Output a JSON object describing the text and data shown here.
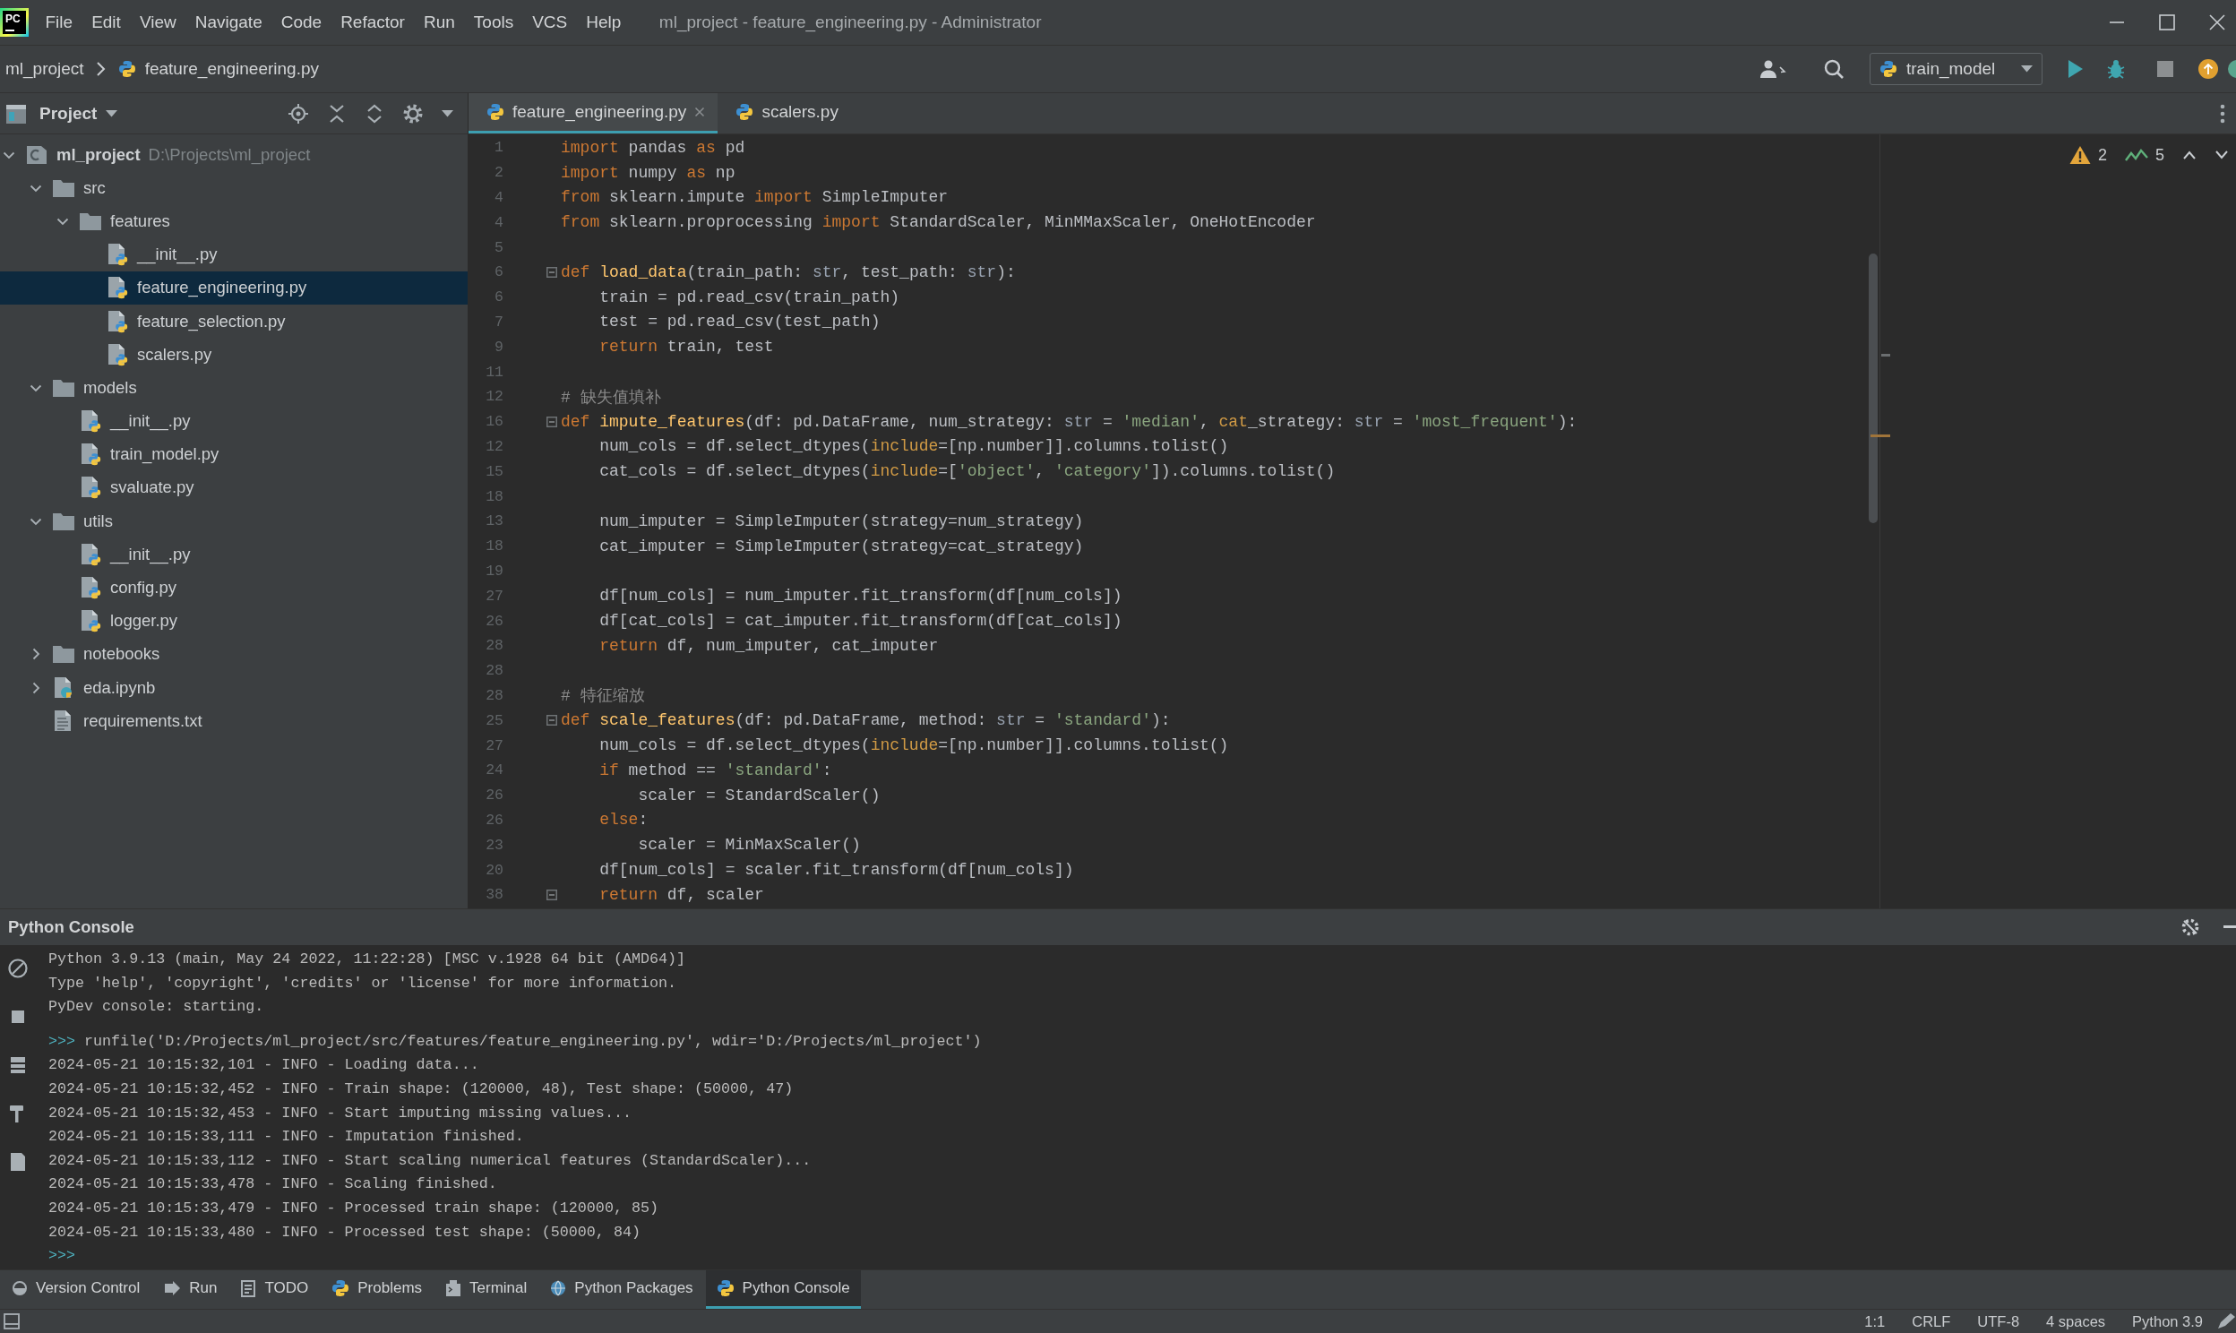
{
  "window": {
    "logo": "PC",
    "menu": [
      "File",
      "Edit",
      "View",
      "Navigate",
      "Code",
      "Refactor",
      "Run",
      "Tools",
      "VCS",
      "Help"
    ],
    "title": "ml_project - feature_engineering.py - Administrator"
  },
  "navigation_bar": {
    "breadcrumb": [
      {
        "label": "ml_project",
        "kind": "project"
      },
      {
        "label": "feature_engineering.py",
        "kind": "python"
      }
    ],
    "run_configuration": "train_model"
  },
  "project_panel": {
    "title": "Project",
    "tree": [
      {
        "name": "ml_project",
        "path": "D:\\Projects\\ml_project",
        "kind": "project",
        "expanded": true,
        "selected": false,
        "children": [
          {
            "name": "src",
            "kind": "folder",
            "expanded": true,
            "selected": false,
            "children": [
              {
                "name": "features",
                "kind": "folder",
                "expanded": true,
                "selected": false,
                "children": [
                  {
                    "name": "__init__.py",
                    "kind": "python",
                    "selected": false
                  },
                  {
                    "name": "feature_engineering.py",
                    "kind": "python",
                    "selected": true
                  },
                  {
                    "name": "feature_selection.py",
                    "kind": "python",
                    "selected": false
                  },
                  {
                    "name": "scalers.py",
                    "kind": "python",
                    "selected": false
                  }
                ]
              }
            ]
          },
          {
            "name": "models",
            "kind": "folder",
            "expanded": true,
            "selected": false,
            "children": [
              {
                "name": "__init__.py",
                "kind": "python",
                "selected": false
              },
              {
                "name": "train_model.py",
                "kind": "python",
                "selected": false
              },
              {
                "name": "svaluate.py",
                "kind": "python",
                "selected": false
              }
            ]
          },
          {
            "name": "utils",
            "kind": "folder",
            "expanded": true,
            "selected": false,
            "children": [
              {
                "name": "__init__.py",
                "kind": "python",
                "selected": false
              },
              {
                "name": "config.py",
                "kind": "python",
                "selected": false
              },
              {
                "name": "logger.py",
                "kind": "python",
                "selected": false
              }
            ]
          },
          {
            "name": "notebooks",
            "kind": "folder",
            "expanded": false,
            "selected": false
          },
          {
            "name": "eda.ipynb",
            "kind": "notebook",
            "expanded": false,
            "selected": false
          },
          {
            "name": "requirements.txt",
            "kind": "text",
            "selected": false
          }
        ]
      }
    ]
  },
  "editor": {
    "tabs": [
      {
        "label": "feature_engineering.py",
        "selected": true,
        "closable": true
      },
      {
        "label": "scalers.py",
        "selected": false,
        "closable": false
      }
    ],
    "inspections": {
      "warnings": "2",
      "weak_warnings": "5"
    },
    "lines": [
      {
        "number": "1",
        "fold_marker": false,
        "tokens": [
          {
            "kind": "keyword",
            "text": "import"
          },
          {
            "kind": "plain",
            "text": " pandas "
          },
          {
            "kind": "keyword",
            "text": "as"
          },
          {
            "kind": "plain",
            "text": " pd"
          }
        ]
      },
      {
        "number": "2",
        "fold_marker": false,
        "tokens": [
          {
            "kind": "keyword",
            "text": "import"
          },
          {
            "kind": "plain",
            "text": " numpy "
          },
          {
            "kind": "keyword",
            "text": "as"
          },
          {
            "kind": "plain",
            "text": " np"
          }
        ]
      },
      {
        "number": "4",
        "fold_marker": false,
        "tokens": [
          {
            "kind": "keyword",
            "text": "from"
          },
          {
            "kind": "plain",
            "text": " sklearn.impute "
          },
          {
            "kind": "keyword",
            "text": "import"
          },
          {
            "kind": "plain",
            "text": " SimpleImputer"
          }
        ]
      },
      {
        "number": "4",
        "fold_marker": false,
        "tokens": [
          {
            "kind": "keyword",
            "text": "from"
          },
          {
            "kind": "plain",
            "text": " sklearn.proprocessing "
          },
          {
            "kind": "keyword",
            "text": "import"
          },
          {
            "kind": "plain",
            "text": " StandardScaler, MinMMaxScaler, OneHotEncoder"
          }
        ]
      },
      {
        "number": "5",
        "fold_marker": false
      },
      {
        "number": "6",
        "fold_marker": true,
        "tokens": [
          {
            "kind": "keyword",
            "text": "def "
          },
          {
            "kind": "function",
            "text": "load_data"
          },
          {
            "kind": "plain",
            "text": "(train_path: "
          },
          {
            "kind": "builtin",
            "text": "str"
          },
          {
            "kind": "plain",
            "text": ", test_path: "
          },
          {
            "kind": "builtin",
            "text": "str"
          },
          {
            "kind": "plain",
            "text": "):"
          }
        ]
      },
      {
        "number": "6",
        "fold_marker": false,
        "tokens": [
          {
            "kind": "plain",
            "text": "    train = pd.read_csv(train_path)"
          }
        ]
      },
      {
        "number": "7",
        "fold_marker": false,
        "tokens": [
          {
            "kind": "plain",
            "text": "    test = pd.read_csv(test_path)"
          }
        ]
      },
      {
        "number": "9",
        "fold_marker": false,
        "tokens": [
          {
            "kind": "keyword",
            "text": "    return"
          },
          {
            "kind": "plain",
            "text": " train, test"
          }
        ]
      },
      {
        "number": "11",
        "fold_marker": false
      },
      {
        "number": "12",
        "fold_marker": false,
        "tokens": [
          {
            "kind": "comment",
            "text": "# 缺失值填补"
          }
        ]
      },
      {
        "number": "16",
        "fold_marker": true,
        "tokens": [
          {
            "kind": "keyword",
            "text": "def "
          },
          {
            "kind": "function",
            "text": "impute_features"
          },
          {
            "kind": "plain",
            "text": "(df: pd.DataFrame, num_strategy: "
          },
          {
            "kind": "builtin",
            "text": "str"
          },
          {
            "kind": "plain",
            "text": " = "
          },
          {
            "kind": "string",
            "text": "'median'"
          },
          {
            "kind": "plain",
            "text": ", "
          },
          {
            "kind": "argument",
            "text": "cat"
          },
          {
            "kind": "plain",
            "text": "_strategy: "
          },
          {
            "kind": "builtin",
            "text": "str"
          },
          {
            "kind": "plain",
            "text": " = "
          },
          {
            "kind": "string",
            "text": "'most_frequent'"
          },
          {
            "kind": "plain",
            "text": "):"
          }
        ]
      },
      {
        "number": "12",
        "fold_marker": false,
        "tokens": [
          {
            "kind": "plain",
            "text": "    num_cols = df.select_dtypes("
          },
          {
            "kind": "argument",
            "text": "include"
          },
          {
            "kind": "plain",
            "text": "=[np.number]].columns.tolist()"
          }
        ]
      },
      {
        "number": "15",
        "fold_marker": false,
        "tokens": [
          {
            "kind": "plain",
            "text": "    cat_cols = df.select_dtypes("
          },
          {
            "kind": "argument",
            "text": "include"
          },
          {
            "kind": "plain",
            "text": "=["
          },
          {
            "kind": "string",
            "text": "'object'"
          },
          {
            "kind": "plain",
            "text": ", "
          },
          {
            "kind": "string",
            "text": "'category'"
          },
          {
            "kind": "plain",
            "text": "]).columns.tolist()"
          }
        ]
      },
      {
        "number": "18",
        "fold_marker": false
      },
      {
        "number": "13",
        "fold_marker": false,
        "tokens": [
          {
            "kind": "plain",
            "text": "    num_imputer = SimpleImputer(strategy=num_strategy)"
          }
        ]
      },
      {
        "number": "18",
        "fold_marker": false,
        "tokens": [
          {
            "kind": "plain",
            "text": "    cat_imputer = SimpleImputer(strategy=cat_strategy)"
          }
        ]
      },
      {
        "number": "19",
        "fold_marker": false
      },
      {
        "number": "27",
        "fold_marker": false,
        "tokens": [
          {
            "kind": "plain",
            "text": "    df[num_cols] = num_imputer.fit_transform(df[num_cols])"
          }
        ]
      },
      {
        "number": "26",
        "fold_marker": false,
        "tokens": [
          {
            "kind": "plain",
            "text": "    df[cat_cols] = cat_imputer.fit_transform(df[cat_cols])"
          }
        ]
      },
      {
        "number": "28",
        "fold_marker": false,
        "tokens": [
          {
            "kind": "keyword",
            "text": "    return"
          },
          {
            "kind": "plain",
            "text": " df, num_imputer, cat_imputer"
          }
        ]
      },
      {
        "number": "28",
        "fold_marker": false
      },
      {
        "number": "28",
        "fold_marker": false,
        "tokens": [
          {
            "kind": "comment",
            "text": "# 特征缩放"
          }
        ]
      },
      {
        "number": "25",
        "fold_marker": true,
        "tokens": [
          {
            "kind": "keyword",
            "text": "def "
          },
          {
            "kind": "function",
            "text": "scale_features"
          },
          {
            "kind": "plain",
            "text": "(df: pd.DataFrame, method: "
          },
          {
            "kind": "builtin",
            "text": "str"
          },
          {
            "kind": "plain",
            "text": " = "
          },
          {
            "kind": "string",
            "text": "'standard'"
          },
          {
            "kind": "plain",
            "text": "):"
          }
        ]
      },
      {
        "number": "27",
        "fold_marker": false,
        "tokens": [
          {
            "kind": "plain",
            "text": "    num_cols = df.select_dtypes("
          },
          {
            "kind": "argument",
            "text": "include"
          },
          {
            "kind": "plain",
            "text": "=[np.number]].columns.tolist()"
          }
        ]
      },
      {
        "number": "24",
        "fold_marker": false,
        "tokens": [
          {
            "kind": "keyword",
            "text": "    if"
          },
          {
            "kind": "plain",
            "text": " method == "
          },
          {
            "kind": "string",
            "text": "'standard'"
          },
          {
            "kind": "plain",
            "text": ":"
          }
        ]
      },
      {
        "number": "26",
        "fold_marker": false,
        "tokens": [
          {
            "kind": "plain",
            "text": "        scaler = StandardScaler()"
          }
        ]
      },
      {
        "number": "26",
        "fold_marker": false,
        "tokens": [
          {
            "kind": "keyword",
            "text": "    else"
          },
          {
            "kind": "plain",
            "text": ":"
          }
        ]
      },
      {
        "number": "23",
        "fold_marker": false,
        "tokens": [
          {
            "kind": "plain",
            "text": "        scaler = MinMaxScaler()"
          }
        ]
      },
      {
        "number": "20",
        "fold_marker": false,
        "tokens": [
          {
            "kind": "plain",
            "text": "    df[num_cols] = scaler.fit_transform(df[num_cols])"
          }
        ]
      },
      {
        "number": "38",
        "fold_marker": true,
        "tokens": [
          {
            "kind": "keyword",
            "text": "    return"
          },
          {
            "kind": "plain",
            "text": " df, scaler"
          }
        ]
      }
    ]
  },
  "console": {
    "title": "Python Console",
    "banner": [
      "Python 3.9.13 (main, May 24 2022, 11:22:28) [MSC v.1928 64 bit (AMD64)]",
      "Type 'help', 'copyright', 'credits' or 'license' for more information.",
      "PyDev console: starting."
    ],
    "session": [
      {
        "prompt": ">>>",
        "text": "runfile('D:/Projects/ml_project/src/features/feature_engineering.py', wdir='D:/Projects/ml_project')"
      },
      {
        "text": "2024-05-21 10:15:32,101 - INFO - Loading data..."
      },
      {
        "text": "2024-05-21 10:15:32,452 - INFO - Train shape: (120000, 48), Test shape: (50000, 47)"
      },
      {
        "text": "2024-05-21 10:15:32,453 - INFO - Start imputing missing values..."
      },
      {
        "text": "2024-05-21 10:15:33,111 - INFO - Imputation finished."
      },
      {
        "text": "2024-05-21 10:15:33,112 - INFO - Start scaling numerical features (StandardScaler)..."
      },
      {
        "text": "2024-05-21 10:15:33,478 - INFO - Scaling finished."
      },
      {
        "text": "2024-05-21 10:15:33,479 - INFO - Processed train shape: (120000, 85)"
      },
      {
        "text": "2024-05-21 10:15:33,480 - INFO - Processed test shape: (50000, 84)"
      },
      {
        "prompt": ">>>"
      }
    ]
  },
  "tool_window_bar": [
    {
      "label": "Version Control",
      "kind": "vcs",
      "selected": false
    },
    {
      "label": "Run",
      "kind": "run",
      "selected": false
    },
    {
      "label": "TODO",
      "kind": "todo",
      "selected": false
    },
    {
      "label": "Problems",
      "kind": "problems",
      "selected": false
    },
    {
      "label": "Terminal",
      "kind": "terminal",
      "selected": false
    },
    {
      "label": "Python Packages",
      "kind": "packages",
      "selected": false
    },
    {
      "label": "Python Console",
      "kind": "console",
      "selected": true
    }
  ],
  "status_bar": [
    "1:1",
    "CRLF",
    "UTF-8",
    "4 spaces",
    "Python 3.9"
  ]
}
